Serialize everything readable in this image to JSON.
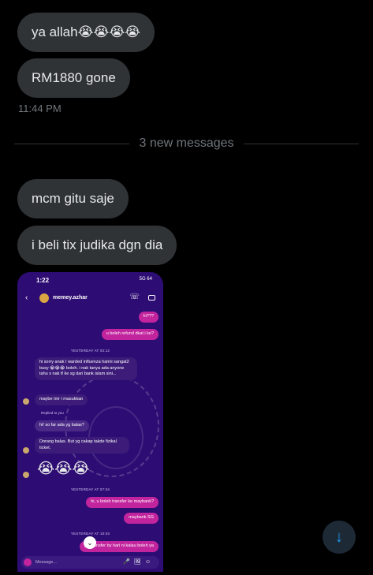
{
  "messages": {
    "first": "ya allah😭😭😭😭",
    "second": "RM1880 gone",
    "timestamp": "11:44 PM",
    "divider": "3 new messages",
    "third": "mcm gitu saje",
    "fourth": "i beli tix judika dgn dia"
  },
  "shot": {
    "time": "1:22",
    "status_right": "5G 64",
    "contact": "memey.azhar",
    "msgs": {
      "m1": "hi???",
      "m2": "u boleh refund dkat i ke?",
      "date1": "YESTERDAY AT 02:12",
      "m3": "hi sorry anak I warded influenza harini sangat2 busy 😭😭😭 boleh. i nak tanya ada anyone tahu x nak tf ke sg dari bank islam sini...",
      "m4": "maybe tmr i masukkan",
      "replied": "Replied to you",
      "m5": "hi! so far ada yg balas?",
      "m6": "Dorang balas. But yg cakap takde fizikal ticket.",
      "emoji": "😭😭😭",
      "date2": "YESTERDAY AT 07:04",
      "m7": "hi, u boleh transfer ke maybank?",
      "m8": "maybank SG",
      "date3": "YESTERDAY AT 10:03",
      "m9": "pls transfer by hari ni kalau boleh ya"
    },
    "composer_placeholder": "Message..."
  },
  "icons": {
    "scroll_down": "arrow-down-icon",
    "back": "chevron-left-icon",
    "call": "phone-icon",
    "video": "video-icon",
    "camera": "camera-icon"
  },
  "colors": {
    "bubble_bg": "#2f3336",
    "accent": "#1d9bf0",
    "shot_bg": "#2d0c73",
    "shot_out_bubble": "#c2249e"
  }
}
